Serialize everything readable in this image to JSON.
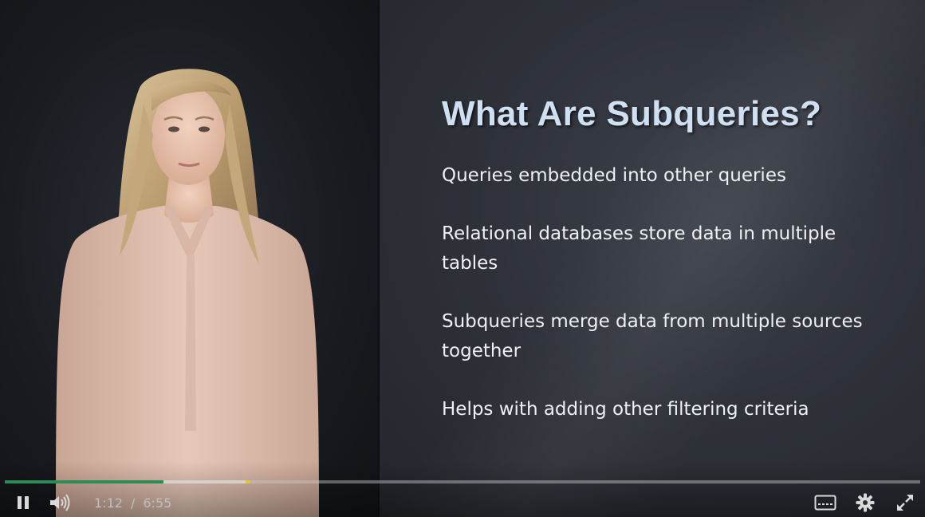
{
  "slide": {
    "title": "What Are Subqueries?",
    "bullets": [
      "Queries embedded into other queries",
      "Relational databases store data in multiple tables",
      "Subqueries merge data from multiple sources together",
      "Helps with adding other filtering criteria"
    ]
  },
  "player": {
    "current_time": "1:12",
    "time_separator": "/",
    "duration": "6:55",
    "played_fraction": 0.173,
    "buffered_fraction": 0.265,
    "marker_fraction": 0.263,
    "icons": {
      "pause": "pause-icon",
      "volume": "volume-icon",
      "captions": "captions-icon",
      "settings": "gear-icon",
      "fullscreen": "fullscreen-icon"
    },
    "colors": {
      "progress_played": "#2e8b57",
      "progress_marker": "#e0c83a",
      "title": "#cfe0f2"
    }
  }
}
